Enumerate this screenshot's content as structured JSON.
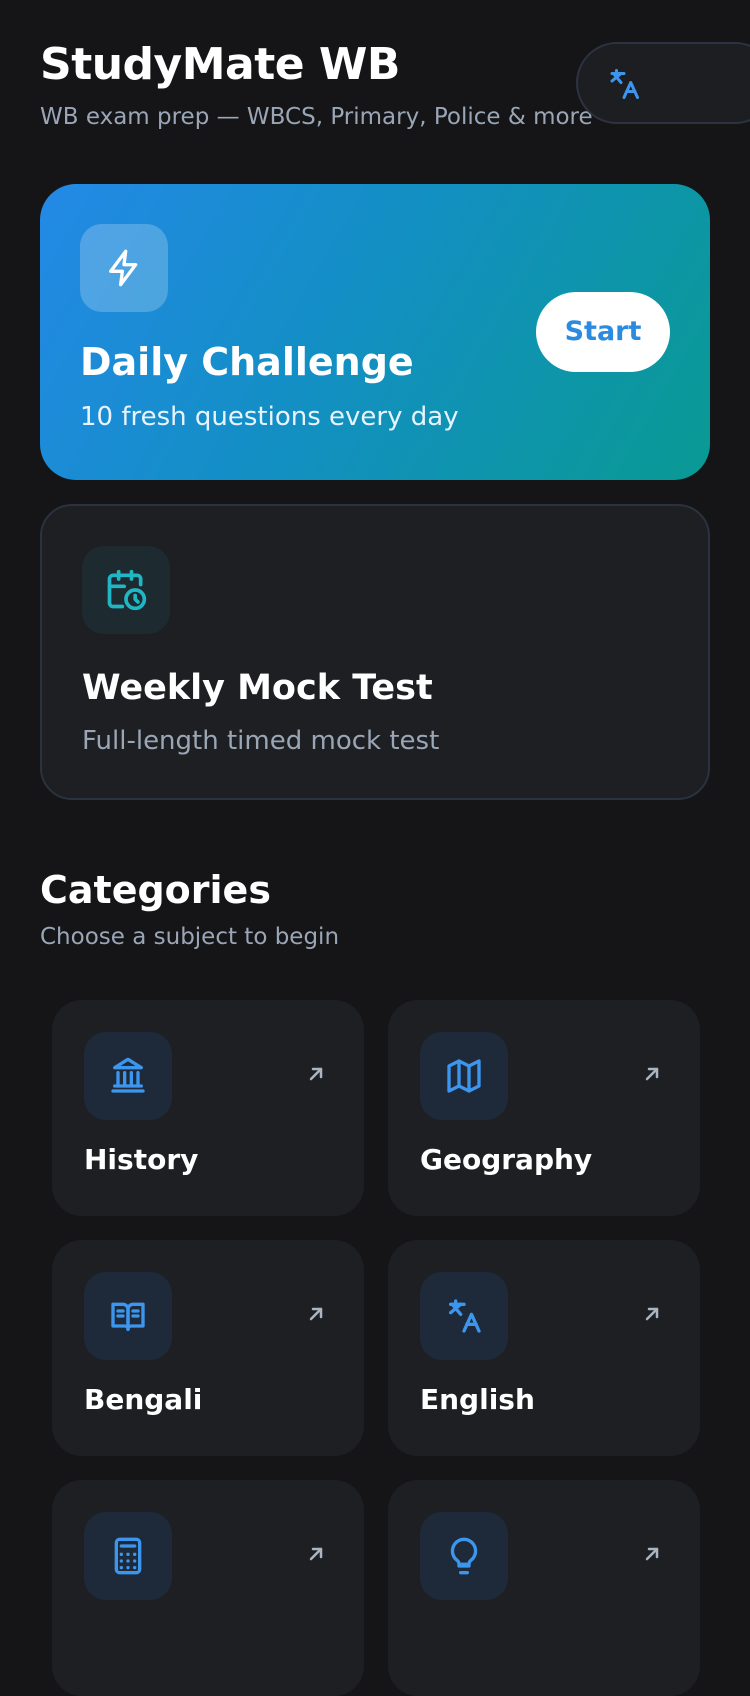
{
  "header": {
    "title": "StudyMate WB",
    "subtitle": "WB exam prep — WBCS, Primary, Police & more",
    "language_icon": "translate-icon"
  },
  "daily_challenge": {
    "icon": "lightning-icon",
    "title": "Daily Challenge",
    "subtitle": "10 fresh questions every day",
    "button_label": "Start"
  },
  "weekly_mock": {
    "icon": "calendar-clock-icon",
    "title": "Weekly Mock Test",
    "subtitle": "Full-length timed mock test"
  },
  "categories": {
    "title": "Categories",
    "subtitle": "Choose a subject to begin",
    "items": [
      {
        "label": "History",
        "icon": "landmark-icon"
      },
      {
        "label": "Geography",
        "icon": "map-icon"
      },
      {
        "label": "Bengali",
        "icon": "book-open-icon"
      },
      {
        "label": "English",
        "icon": "translate-icon"
      },
      {
        "label": "",
        "icon": "calculator-icon"
      },
      {
        "label": "",
        "icon": "lightbulb-icon"
      }
    ]
  },
  "colors": {
    "background": "#151517",
    "accent_blue": "#3d96ee",
    "accent_teal": "#1fb7c6",
    "card": "#1e1f22",
    "muted_text": "#9aa6b6"
  }
}
